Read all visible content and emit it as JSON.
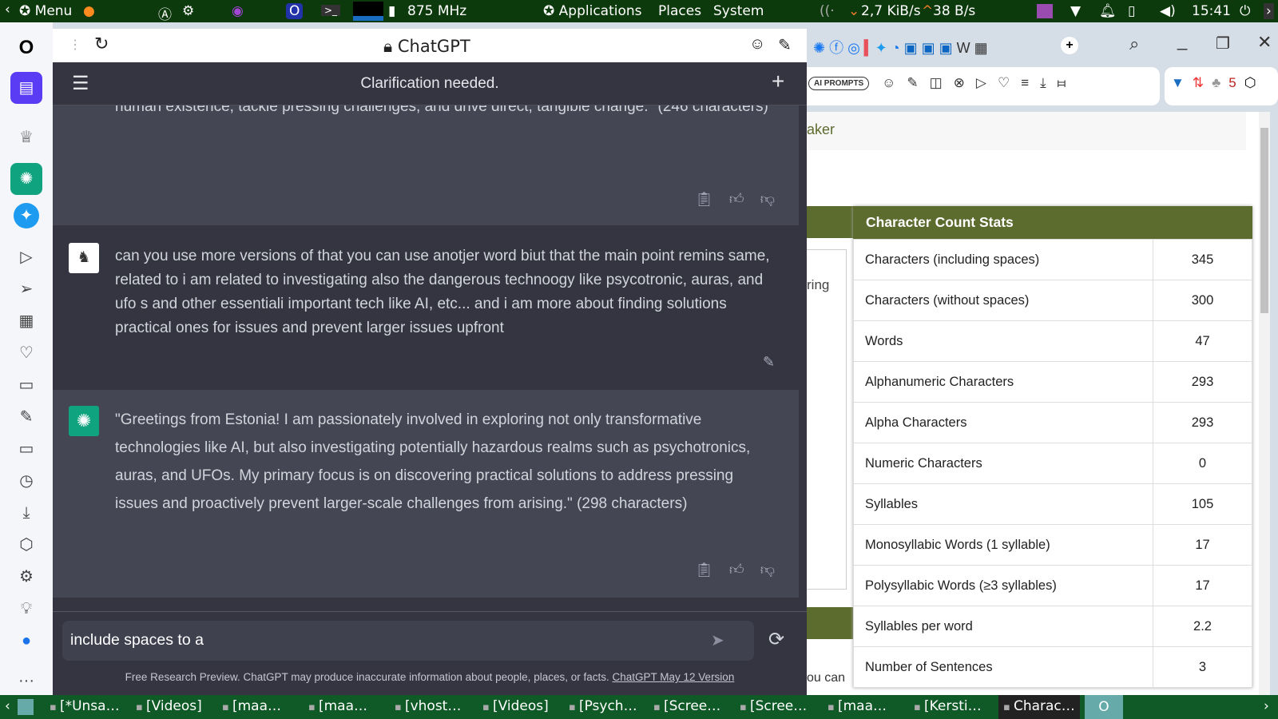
{
  "top_panel": {
    "menu": "Menu",
    "cpu_freq": "875 MHz",
    "applications": "Applications",
    "places": "Places",
    "system": "System",
    "net_down": "2,7 KiB/s",
    "net_up": "38 B/s",
    "clock": "15:41"
  },
  "browser": {
    "tab_title": "ChatGPT",
    "ai_prompts": "AI PROMPTS"
  },
  "chat": {
    "header_title": "Clarification needed.",
    "messages": [
      {
        "role": "assistant",
        "text": "human existence, tackle pressing challenges, and drive direct, tangible change.\" (246 characters)"
      },
      {
        "role": "user",
        "text": "can you use more versions of that you can use anotjer word biut that the main point remins same, related to i am related to investigating also the dangerous technoogy like psycotronic, auras, and ufo s and other essentiali important tech like AI, etc... and i am more about finding solutions practical ones for issues and prevent larger issues upfront"
      },
      {
        "role": "assistant",
        "text": "\"Greetings from Estonia! I am passionately involved in exploring not only transformative technologies like AI, but also investigating potentially hazardous realms such as psychotronics, auras, and UFOs. My primary focus is on discovering practical solutions to address pressing issues and proactively prevent larger-scale challenges from arising.\" (298 characters)"
      }
    ],
    "input_value": "include spaces to a",
    "footer_text": "Free Research Preview. ChatGPT may produce inaccurate information about people, places, or facts.",
    "footer_link": "ChatGPT May 12 Version"
  },
  "page": {
    "partial_heading": "aker",
    "partial_text1": "ring",
    "partial_text2": "ou can",
    "stats_title": "Character Count Stats",
    "stats": [
      {
        "label": "Characters (including spaces)",
        "value": "345"
      },
      {
        "label": "Characters (without spaces)",
        "value": "300"
      },
      {
        "label": "Words",
        "value": "47"
      },
      {
        "label": "Alphanumeric Characters",
        "value": "293"
      },
      {
        "label": "Alpha Characters",
        "value": "293"
      },
      {
        "label": "Numeric Characters",
        "value": "0"
      },
      {
        "label": "Syllables",
        "value": "105"
      },
      {
        "label": "Monosyllabic Words (1 syllable)",
        "value": "17"
      },
      {
        "label": "Polysyllabic Words (≥3 syllables)",
        "value": "17"
      },
      {
        "label": "Syllables per word",
        "value": "2.2"
      },
      {
        "label": "Number of Sentences",
        "value": "3"
      }
    ]
  },
  "taskbar": {
    "items": [
      "[*Unsa…",
      "[Videos]",
      "[maa…",
      "[maa…",
      "[vhost…",
      "[Videos]",
      "[Psych…",
      "[Scree…",
      "[Scree…",
      "[maa…",
      "[Kersti…",
      "Charac…"
    ]
  },
  "colors": {
    "stats_header": "#5c6b2e",
    "chat_bg": "#343541",
    "assistant_bg": "#444654",
    "chatgpt_green": "#10a37f"
  }
}
